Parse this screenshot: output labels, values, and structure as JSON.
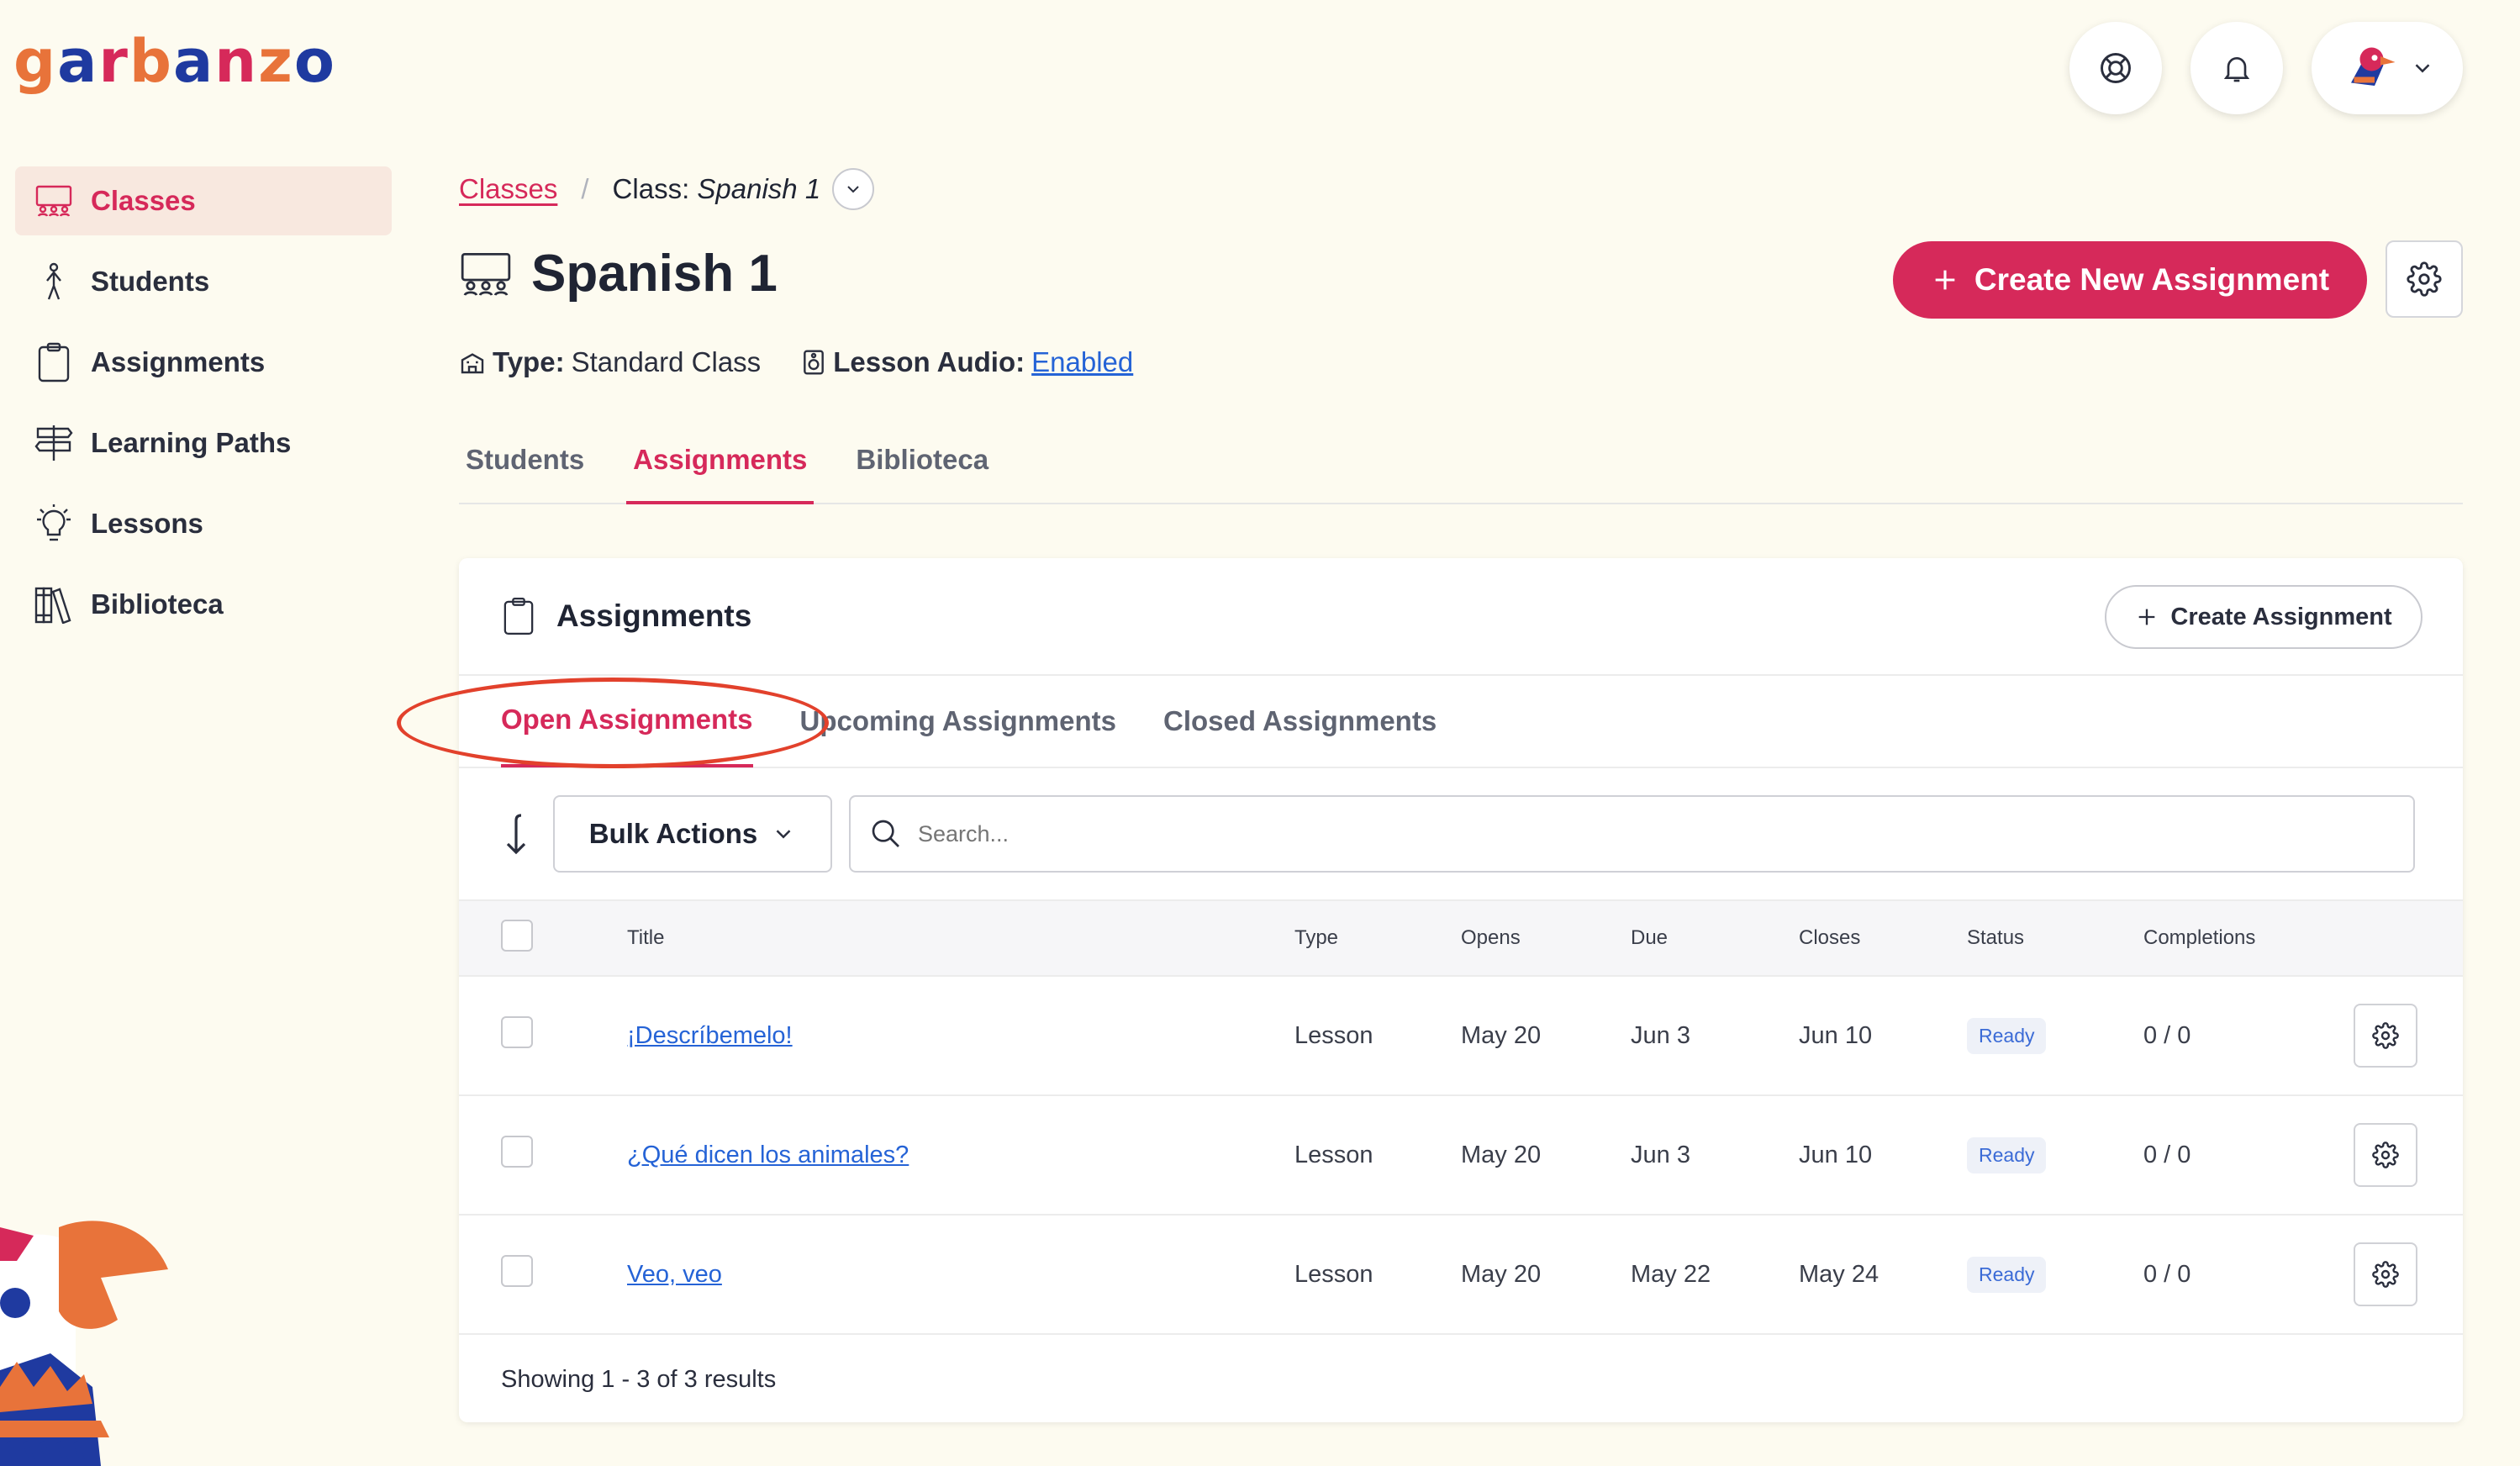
{
  "brand": {
    "logo_letters": [
      {
        "ch": "g",
        "color": "#e8733a"
      },
      {
        "ch": "a",
        "color": "#1f3aa0"
      },
      {
        "ch": "r",
        "color": "#d6295a"
      },
      {
        "ch": "b",
        "color": "#e8733a"
      },
      {
        "ch": "a",
        "color": "#1f3aa0"
      },
      {
        "ch": "n",
        "color": "#d6295a"
      },
      {
        "ch": "z",
        "color": "#e8733a"
      },
      {
        "ch": "o",
        "color": "#1f3aa0"
      }
    ]
  },
  "header": {
    "help_icon": "lifebuoy-icon",
    "notifications_icon": "bell-icon",
    "user_icon": "bird-avatar"
  },
  "sidebar": {
    "items": [
      {
        "label": "Classes",
        "icon": "classroom-icon",
        "active": true
      },
      {
        "label": "Students",
        "icon": "student-icon"
      },
      {
        "label": "Assignments",
        "icon": "clipboard-icon"
      },
      {
        "label": "Learning Paths",
        "icon": "signpost-icon"
      },
      {
        "label": "Lessons",
        "icon": "lightbulb-icon"
      },
      {
        "label": "Biblioteca",
        "icon": "books-icon"
      }
    ]
  },
  "breadcrumb": {
    "root": "Classes",
    "separator": "/",
    "current_prefix": "Class:",
    "current_name": "Spanish 1"
  },
  "page": {
    "title": "Spanish 1",
    "type_label": "Type:",
    "type_value": "Standard Class",
    "audio_label": "Lesson Audio:",
    "audio_value": "Enabled",
    "create_new_label": "Create New Assignment"
  },
  "tabs": [
    {
      "label": "Students"
    },
    {
      "label": "Assignments",
      "active": true
    },
    {
      "label": "Biblioteca"
    }
  ],
  "card": {
    "title": "Assignments",
    "create_label": "Create Assignment",
    "subtabs": [
      {
        "label": "Open Assignments",
        "active": true
      },
      {
        "label": "Upcoming Assignments"
      },
      {
        "label": "Closed Assignments"
      }
    ],
    "bulk_label": "Bulk Actions",
    "search_placeholder": "Search...",
    "columns": [
      "Title",
      "Type",
      "Opens",
      "Due",
      "Closes",
      "Status",
      "Completions"
    ],
    "rows": [
      {
        "title": "¡Descríbemelo!",
        "type": "Lesson",
        "opens": "May 20",
        "due": "Jun 3",
        "closes": "Jun 10",
        "status": "Ready",
        "completions": "0 / 0"
      },
      {
        "title": "¿Qué dicen los animales?",
        "type": "Lesson",
        "opens": "May 20",
        "due": "Jun 3",
        "closes": "Jun 10",
        "status": "Ready",
        "completions": "0 / 0"
      },
      {
        "title": "Veo, veo",
        "type": "Lesson",
        "opens": "May 20",
        "due": "May 22",
        "closes": "May 24",
        "status": "Ready",
        "completions": "0 / 0"
      }
    ],
    "footer": "Showing 1 - 3 of 3 results"
  },
  "colors": {
    "accent": "#d6295a",
    "link": "#2563d6",
    "background": "#fdfbf0",
    "annotation": "#e2412c"
  }
}
